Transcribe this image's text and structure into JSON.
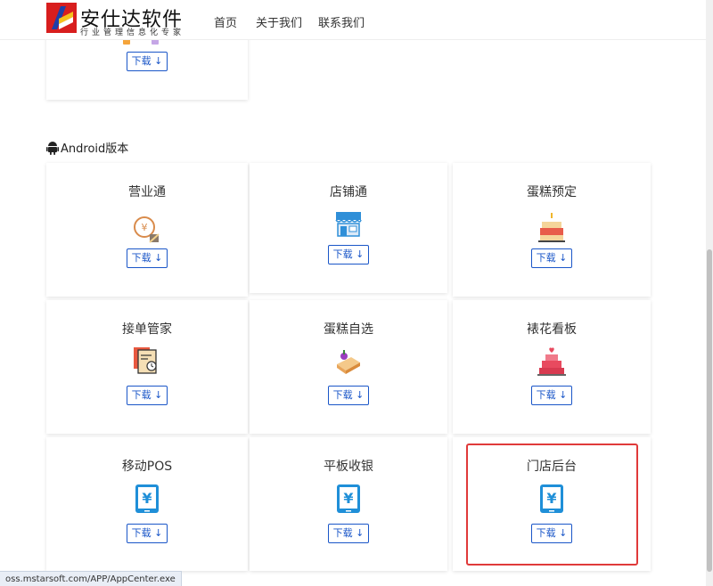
{
  "header": {
    "brand_name": "安仕达软件",
    "brand_slogan": "行业管理信息化专家",
    "nav": [
      "首页",
      "关于我们",
      "联系我们"
    ]
  },
  "partial_card": {
    "download_label": "下载 ↓"
  },
  "android_section": {
    "title": "Android版本",
    "apps": [
      {
        "name": "营业通",
        "icon": "yuan-coin-icon",
        "download_label": "下载 ↓"
      },
      {
        "name": "店铺通",
        "icon": "storefront-icon",
        "download_label": "下载 ↓"
      },
      {
        "name": "蛋糕预定",
        "icon": "birthday-cake-icon",
        "download_label": "下载 ↓"
      },
      {
        "name": "接单管家",
        "icon": "receipt-clock-icon",
        "download_label": "下载 ↓"
      },
      {
        "name": "蛋糕自选",
        "icon": "cake-slice-icon",
        "download_label": "下载 ↓"
      },
      {
        "name": "裱花看板",
        "icon": "tiered-cake-icon",
        "download_label": "下载 ↓"
      },
      {
        "name": "移动POS",
        "icon": "phone-yuan-icon",
        "download_label": "下载 ↓"
      },
      {
        "name": "平板收银",
        "icon": "phone-yuan-icon",
        "download_label": "下载 ↓"
      },
      {
        "name": "门店后台",
        "icon": "phone-yuan-icon",
        "download_label": "下载 ↓"
      }
    ]
  },
  "status_bar": {
    "url": "oss.mstarsoft.com/APP/AppCenter.exe"
  },
  "colors": {
    "accent": "#1a56c8",
    "highlight": "#e03a3a",
    "phone_icon": "#1f8fd8"
  }
}
